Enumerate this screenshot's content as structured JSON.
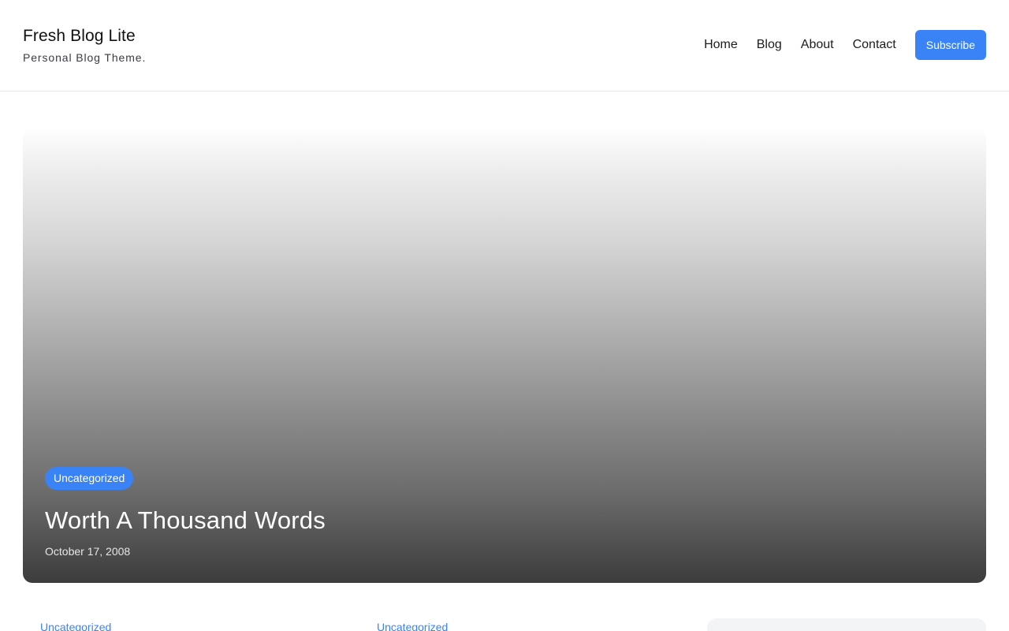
{
  "site": {
    "title": "Fresh Blog Lite",
    "tagline": "Personal Blog Theme."
  },
  "nav": {
    "items": [
      {
        "label": "Home"
      },
      {
        "label": "Blog"
      },
      {
        "label": "About"
      },
      {
        "label": "Contact"
      }
    ],
    "subscribe_label": "Subscribe"
  },
  "hero": {
    "category": "Uncategorized",
    "title": "Worth A Thousand Words",
    "date": "October 17, 2008"
  },
  "posts": [
    {
      "category": "Uncategorized"
    },
    {
      "category": "Uncategorized"
    }
  ],
  "colors": {
    "accent": "#3a83f6"
  }
}
